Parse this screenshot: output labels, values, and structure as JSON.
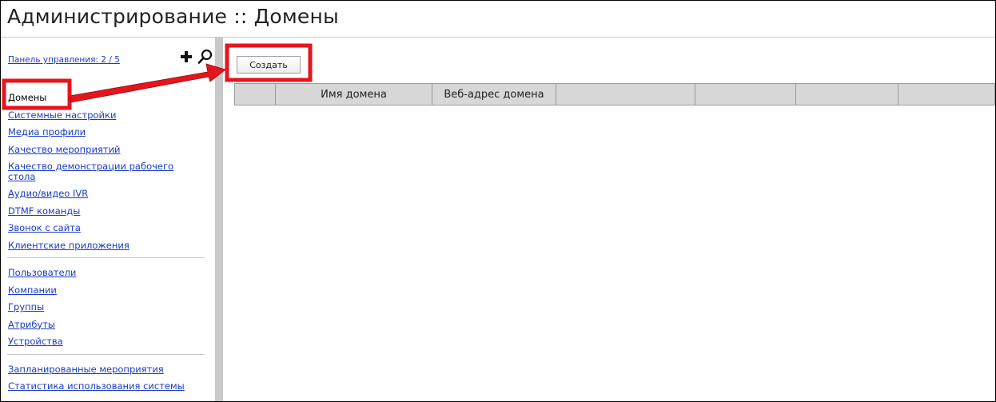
{
  "header": {
    "title": "Администрирование :: Домены"
  },
  "sidebar": {
    "panel_link": "Панель управления: 2 / 5",
    "groups": [
      {
        "items": [
          {
            "label": "Домены",
            "active": true
          },
          {
            "label": "Системные настройки"
          },
          {
            "label": "Медиа профили"
          },
          {
            "label": "Качество мероприятий"
          },
          {
            "label": "Качество демонстрации рабочего стола"
          },
          {
            "label": "Аудио/видео IVR"
          },
          {
            "label": "DTMF команды"
          },
          {
            "label": "Звонок с сайта"
          },
          {
            "label": "Клиентские приложения"
          }
        ]
      },
      {
        "items": [
          {
            "label": "Пользователи"
          },
          {
            "label": "Компании"
          },
          {
            "label": "Группы"
          },
          {
            "label": "Атрибуты"
          },
          {
            "label": "Устройства"
          }
        ]
      },
      {
        "items": [
          {
            "label": "Запланированные мероприятия"
          },
          {
            "label": "Статистика использования системы"
          }
        ]
      }
    ]
  },
  "toolbar": {
    "create_label": "Создать"
  },
  "table": {
    "columns": [
      "",
      "Имя домена",
      "Веб-адрес домена",
      "",
      "",
      "",
      ""
    ]
  },
  "annotation": {
    "color": "#e8141c"
  }
}
